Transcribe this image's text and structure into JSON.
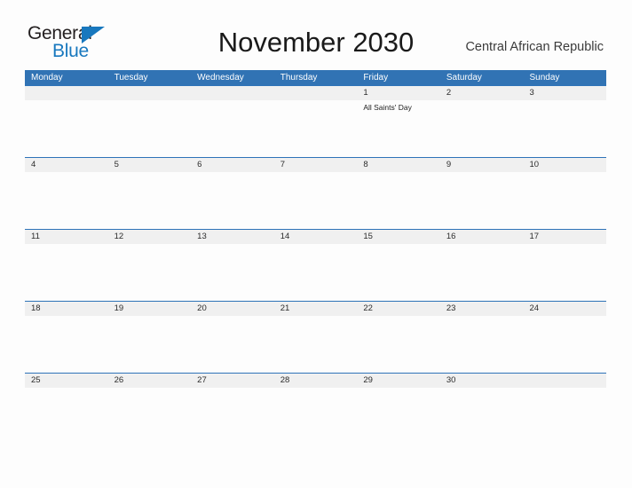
{
  "brand": {
    "name_top": "General",
    "name_bottom": "Blue",
    "accent_color": "#1878be"
  },
  "header": {
    "title": "November 2030",
    "region": "Central African Republic"
  },
  "theme": {
    "header_blue": "#3173b4",
    "row_divider_blue": "#2e73b8",
    "date_strip_gray": "#f0f0f0",
    "page_background": "#fdfdfd"
  },
  "calendar": {
    "weekday_headers": [
      "Monday",
      "Tuesday",
      "Wednesday",
      "Thursday",
      "Friday",
      "Saturday",
      "Sunday"
    ],
    "weeks": [
      {
        "days": [
          {
            "date": "",
            "events": []
          },
          {
            "date": "",
            "events": []
          },
          {
            "date": "",
            "events": []
          },
          {
            "date": "",
            "events": []
          },
          {
            "date": "1",
            "events": [
              "All Saints' Day"
            ]
          },
          {
            "date": "2",
            "events": []
          },
          {
            "date": "3",
            "events": []
          }
        ]
      },
      {
        "days": [
          {
            "date": "4",
            "events": []
          },
          {
            "date": "5",
            "events": []
          },
          {
            "date": "6",
            "events": []
          },
          {
            "date": "7",
            "events": []
          },
          {
            "date": "8",
            "events": []
          },
          {
            "date": "9",
            "events": []
          },
          {
            "date": "10",
            "events": []
          }
        ]
      },
      {
        "days": [
          {
            "date": "11",
            "events": []
          },
          {
            "date": "12",
            "events": []
          },
          {
            "date": "13",
            "events": []
          },
          {
            "date": "14",
            "events": []
          },
          {
            "date": "15",
            "events": []
          },
          {
            "date": "16",
            "events": []
          },
          {
            "date": "17",
            "events": []
          }
        ]
      },
      {
        "days": [
          {
            "date": "18",
            "events": []
          },
          {
            "date": "19",
            "events": []
          },
          {
            "date": "20",
            "events": []
          },
          {
            "date": "21",
            "events": []
          },
          {
            "date": "22",
            "events": []
          },
          {
            "date": "23",
            "events": []
          },
          {
            "date": "24",
            "events": []
          }
        ]
      },
      {
        "days": [
          {
            "date": "25",
            "events": []
          },
          {
            "date": "26",
            "events": []
          },
          {
            "date": "27",
            "events": []
          },
          {
            "date": "28",
            "events": []
          },
          {
            "date": "29",
            "events": []
          },
          {
            "date": "30",
            "events": []
          },
          {
            "date": "",
            "events": []
          }
        ]
      }
    ]
  }
}
